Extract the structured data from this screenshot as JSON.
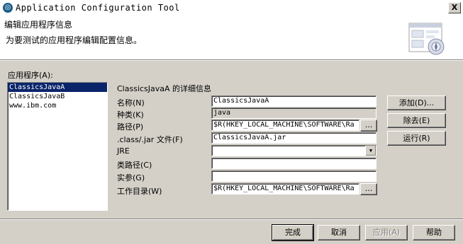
{
  "window": {
    "title": "Application Configuration Tool",
    "close_label": "X"
  },
  "header": {
    "title": "编辑应用程序信息",
    "subtitle": "为要测试的应用程序编辑配置信息。"
  },
  "apps_label": "应用程序(A):",
  "apps": [
    "ClassicsJavaA",
    "ClassicsJavaB",
    "www.ibm.com"
  ],
  "selected_app_index": 0,
  "details": {
    "heading": "ClassicsJavaA 的详细信息",
    "name_label": "名称(N)",
    "name_value": "ClassicsJavaA",
    "kind_label": "种类(K)",
    "kind_value": "java",
    "path_label": "路径(P)",
    "path_value": "$R(HKEY_LOCAL_MACHINE\\SOFTWARE\\Ra",
    "path_browse": "...",
    "file_label": ".class/.jar 文件(F)",
    "file_value": "ClassicsJavaA.jar",
    "jre_label": "JRE",
    "jre_value": "",
    "classpath_label": "类路径(C)",
    "classpath_value": "",
    "args_label": "实参(G)",
    "args_value": "",
    "workdir_label": "工作目录(W)",
    "workdir_value": "$R(HKEY_LOCAL_MACHINE\\SOFTWARE\\Ra",
    "workdir_browse": "..."
  },
  "side_buttons": {
    "add": "添加(D)...",
    "remove": "除去(E)",
    "run": "运行(R)"
  },
  "footer_buttons": {
    "finish": "完成",
    "cancel": "取消",
    "apply": "应用(A)",
    "help": "帮助"
  }
}
